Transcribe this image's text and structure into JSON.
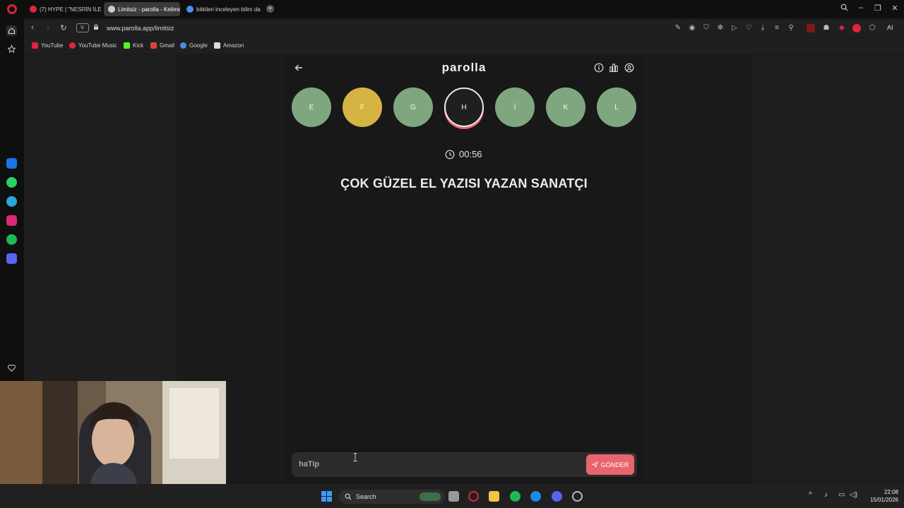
{
  "browser": {
    "tabs": [
      {
        "label": "(7) HYPE | \"NESRİN İLE PA",
        "icon_color": "#e0263a",
        "active": false
      },
      {
        "label": "Limitsiz - parolla - Kelime",
        "icon_color": "#cccccc",
        "active": true
      },
      {
        "label": "bitkileri inceleyen bilim da",
        "icon_color": "#4a8ef0",
        "active": false
      }
    ],
    "new_tab_label": "+",
    "url": "www.parolla.app/limitsiz",
    "v_badge": "V.",
    "ai_label": "AI",
    "bookmarks": [
      {
        "label": "YouTube",
        "icon_color": "#e0263a"
      },
      {
        "label": "YouTube Music",
        "icon_color": "#e0263a"
      },
      {
        "label": "Kick",
        "icon_color": "#53fc18"
      },
      {
        "label": "Gmail",
        "icon_color": "#d44638"
      },
      {
        "label": "Google",
        "icon_color": "#4a8ef0"
      },
      {
        "label": "Amazon",
        "icon_color": "#dddddd"
      }
    ]
  },
  "app": {
    "title": "parolla",
    "letters": [
      {
        "char": "E",
        "state": "correct"
      },
      {
        "char": "F",
        "state": "pass"
      },
      {
        "char": "G",
        "state": "correct"
      },
      {
        "char": "H",
        "state": "current"
      },
      {
        "char": "İ",
        "state": "correct"
      },
      {
        "char": "K",
        "state": "correct"
      },
      {
        "char": "L",
        "state": "correct"
      }
    ],
    "timer": "00:56",
    "question": "ÇOK GÜZEL EL YAZISI YAZAN SANATÇI",
    "answer_value": "haTip",
    "send_label": "GÖNDER",
    "colors": {
      "correct": "#7fa77f",
      "pass": "#d6b443",
      "accent": "#e8646e"
    }
  },
  "taskbar": {
    "search_label": "Search",
    "time": "22:08",
    "date": "15/01/2026"
  }
}
